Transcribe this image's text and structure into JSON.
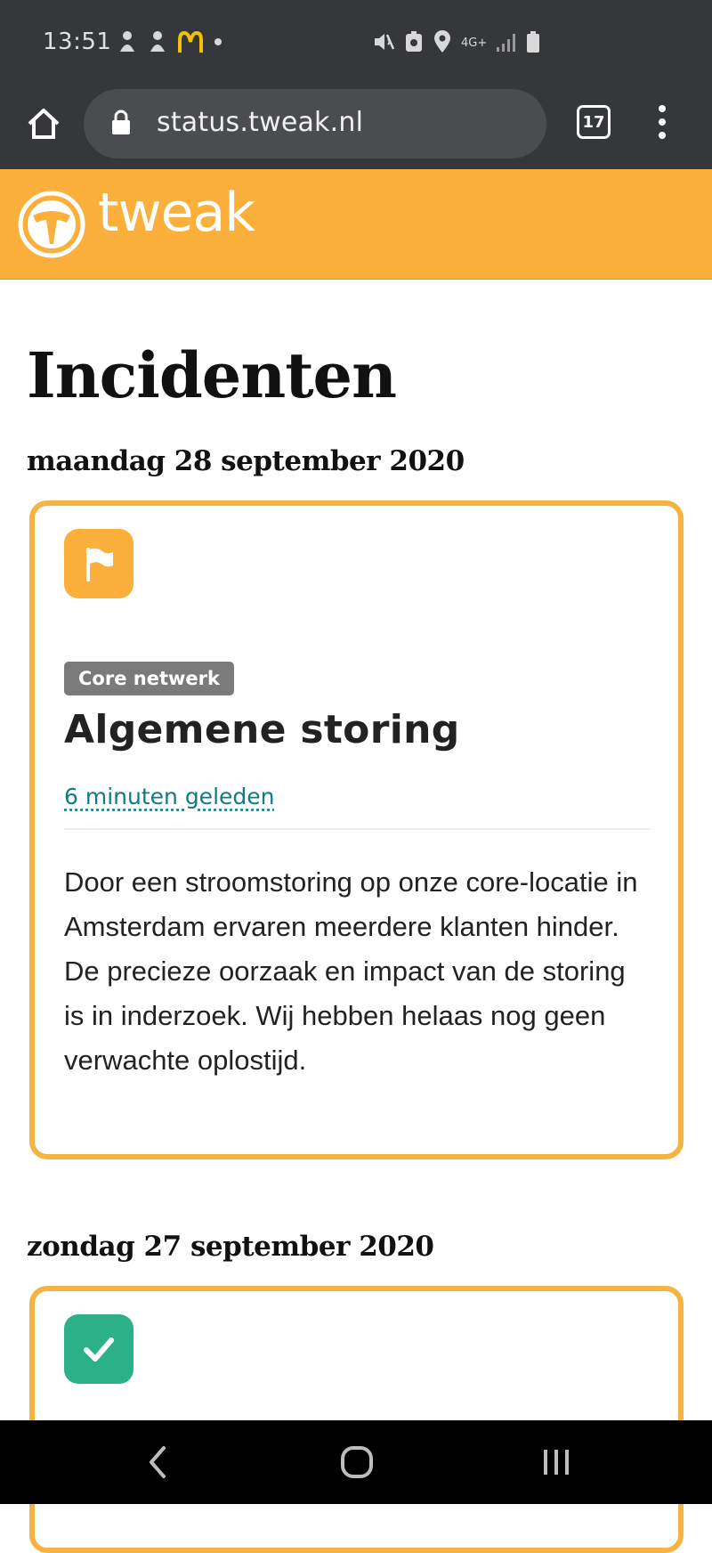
{
  "status_bar": {
    "time": "13:51",
    "network": "4G+"
  },
  "browser": {
    "url": "status.tweak.nl",
    "tab_count": "17"
  },
  "site": {
    "logo_text": "tweak",
    "logo_color": "#fbb03b"
  },
  "page": {
    "title": "Incidenten"
  },
  "days": [
    {
      "date": "maandag 28 september 2020",
      "incidents": [
        {
          "icon": "flag-icon",
          "icon_color": "#fbb03b",
          "category": "Core netwerk",
          "title": "Algemene storing",
          "time": "6 minuten geleden",
          "body": "Door een stroomstoring op onze core-locatie in Amsterdam ervaren meerdere klanten hinder. De precieze oorzaak en impact van de storing is in inderzoek. Wij hebben helaas nog geen verwachte oplostijd."
        }
      ]
    },
    {
      "date": "zondag 27 september 2020",
      "incidents": [
        {
          "icon": "checkmark-icon",
          "icon_color": "#2bb088"
        }
      ]
    }
  ]
}
